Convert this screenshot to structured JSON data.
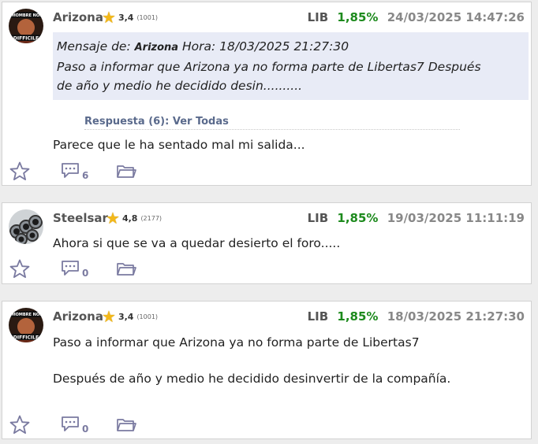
{
  "posts": [
    {
      "username": "Arizona",
      "score": "3,4",
      "count": "(1001)",
      "ticker": "LIB",
      "change": "1,85%",
      "date": "24/03/2025 14:47:26",
      "quote": {
        "prefix": "Mensaje de:",
        "user": "Arizona",
        "hora": "Hora: 18/03/2025 21:27:30",
        "line1": "Paso a informar que Arizona ya no forma parte de Libertas7 Después",
        "line2": "de año y medio he decidido desin.........."
      },
      "replies_label": "Respuesta (6): Ver Todas",
      "body": "Parece que le ha sentado mal mi salida...",
      "comments": "6"
    },
    {
      "username": "Steelsar",
      "score": "4,8",
      "count": "(2177)",
      "ticker": "LIB",
      "change": "1,85%",
      "date": "19/03/2025 11:11:19",
      "body": "Ahora si que se va a quedar desierto el foro.....",
      "comments": "0"
    },
    {
      "username": "Arizona",
      "score": "3,4",
      "count": "(1001)",
      "ticker": "LIB",
      "change": "1,85%",
      "date": "18/03/2025 21:27:30",
      "body_line1": "Paso a informar que Arizona ya no forma parte de Libertas7",
      "body_line2": "Después de año y medio he decidido desinvertir de la compañía.",
      "comments": "0"
    }
  ],
  "avatar_text": {
    "top": "UN HOMBRE NOBLE",
    "bottom": "DIFFICILE"
  },
  "colors": {
    "positive": "#1d8a1d",
    "quote_bg": "#e8ebf6",
    "icon": "#7a7aa0",
    "star": "#f3b81a"
  }
}
